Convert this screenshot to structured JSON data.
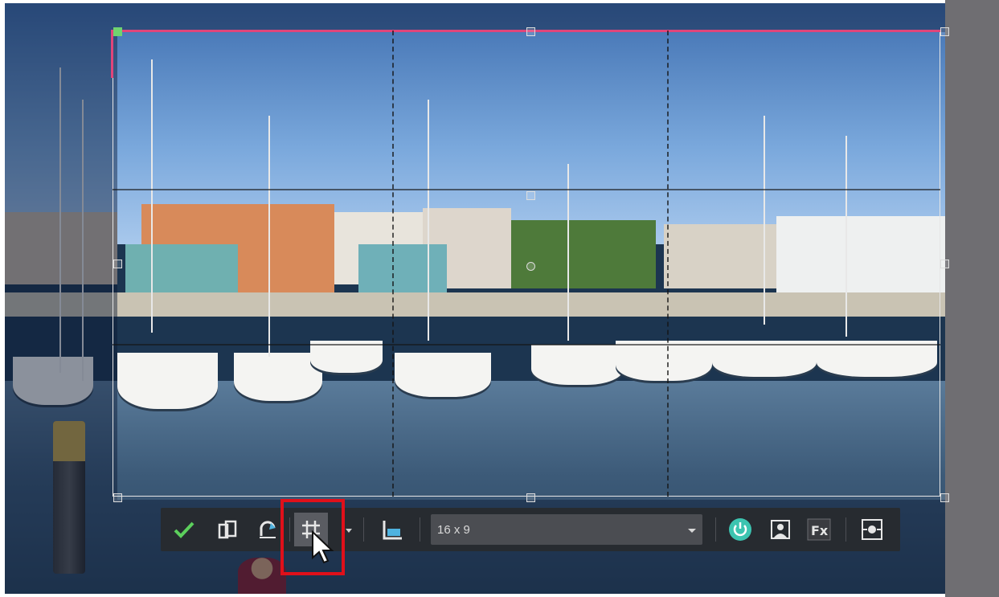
{
  "editor": {
    "mode": "crop",
    "grid_overlay": "rule-of-thirds"
  },
  "toolbar": {
    "buttons": [
      {
        "name": "apply-crop-button",
        "icon": "checkmark-icon"
      },
      {
        "name": "rotate-crop-button",
        "icon": "rotate-crop-icon"
      },
      {
        "name": "undo-button",
        "icon": "undo-arrow-icon"
      },
      {
        "name": "grid-overlay-button",
        "icon": "grid-icon"
      },
      {
        "name": "crop-orientation-button",
        "icon": "orientation-icon"
      },
      {
        "name": "preview-toggle-button",
        "icon": "power-icon"
      },
      {
        "name": "person-detect-button",
        "icon": "person-icon"
      },
      {
        "name": "effects-button",
        "icon": "fx-icon"
      },
      {
        "name": "center-focus-button",
        "icon": "focus-frame-icon"
      }
    ],
    "aspect_ratio": {
      "selected": "16 x 9"
    },
    "highlighted_button": "grid-overlay-button"
  },
  "colors": {
    "crop_accent": "#e0457a",
    "apply_check": "#5ccf5c",
    "power_teal": "#3cc4b0",
    "highlight_red": "#e0101a",
    "toolbar_bg": "#28292e"
  }
}
